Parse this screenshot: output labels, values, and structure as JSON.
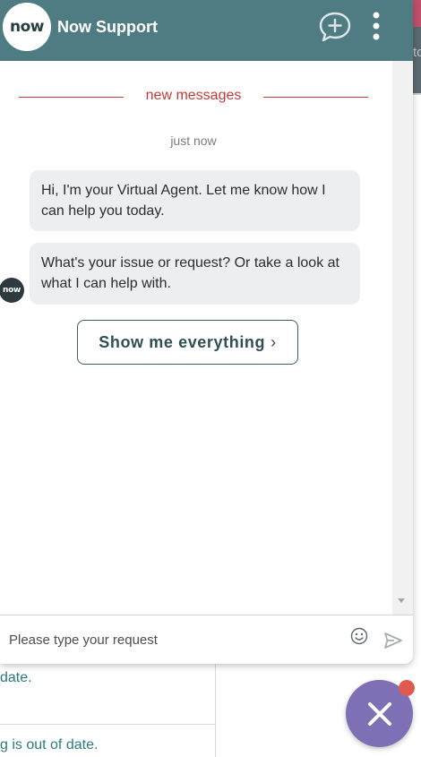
{
  "header": {
    "logo_text": "now",
    "title": "Now Support",
    "new_chat_icon": "chat-plus-icon",
    "menu_icon": "kebab-menu-icon"
  },
  "transcript": {
    "separator_label": "new messages",
    "timestamp": "just now",
    "messages": [
      {
        "sender": "agent",
        "text": "Hi, I'm your Virtual Agent. Let me know how I can help you today."
      },
      {
        "sender": "agent",
        "text": "What's your issue or request? Or take a look at what I can help with."
      }
    ],
    "avatar_text": "now",
    "action_button": {
      "label": "Show me everything",
      "chevron": "›"
    }
  },
  "composer": {
    "placeholder": "Please type your request",
    "value": "",
    "emoji_icon": "smiley-icon",
    "send_icon": "send-icon"
  },
  "background_page": {
    "text_1": "date.",
    "text_2": "g is out of date.",
    "right_text": "to"
  },
  "fab": {
    "icon": "close-icon"
  },
  "colors": {
    "header_bg": "#4f7b83",
    "accent_red": "#c23a3a",
    "bubble_bg": "#eceef1",
    "fab_bg": "#7f6fb5",
    "badge": "#e05a4f"
  }
}
